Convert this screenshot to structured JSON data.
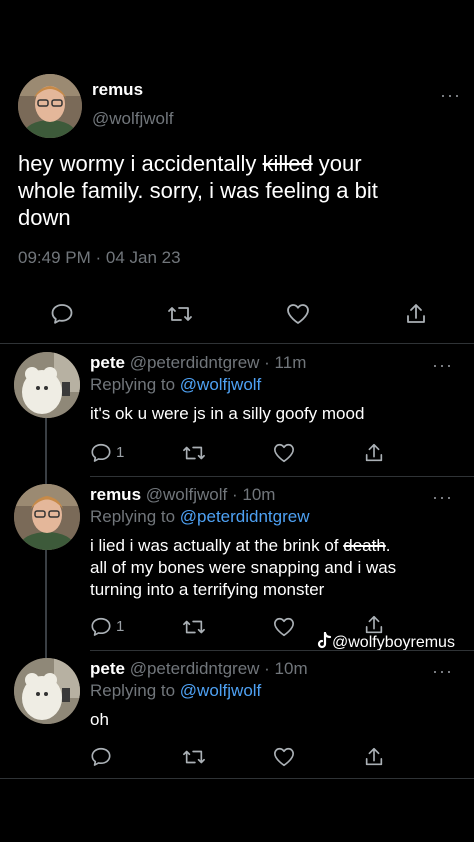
{
  "main_tweet": {
    "name": "remus",
    "handle": "@wolfjwolf",
    "text_before": "hey wormy i accidentally ",
    "struck": "killed",
    "text_after_line1": " your",
    "text_line2": "whole family. sorry, i was feeling a bit",
    "text_line3": "down",
    "timestamp": "09:49 PM · 04 Jan 23",
    "more": "···"
  },
  "replies": [
    {
      "name": "pete",
      "handle": "@peterdidntgrew",
      "time": "· 11m",
      "replying_prefix": "Replying to ",
      "replying_to": "@wolfjwolf",
      "text": "it's ok u were js in a silly goofy mood",
      "reply_count": "1",
      "more": "···"
    },
    {
      "name": "remus",
      "handle": "@wolfjwolf",
      "time": "· 10m",
      "replying_prefix": "Replying to ",
      "replying_to": "@peterdidntgrew",
      "text_line1": "i lied i was actually at the brink of ",
      "struck": "death",
      "text_line1_end": ".",
      "text_line2": "all of my bones were snapping and i was",
      "text_line3": "turning into a terrifying monster",
      "reply_count": "1",
      "more": "···"
    },
    {
      "name": "pete",
      "handle": "@peterdidntgrew",
      "time": "· 10m",
      "replying_prefix": "Replying to ",
      "replying_to": "@wolfjwolf",
      "text": "oh",
      "more": "···"
    }
  ],
  "watermark": {
    "text": "@wolfyboyremus",
    "icon": "tiktok-icon"
  },
  "colors": {
    "background": "#000000",
    "link": "#4ea1f3",
    "muted": "#71767b"
  }
}
